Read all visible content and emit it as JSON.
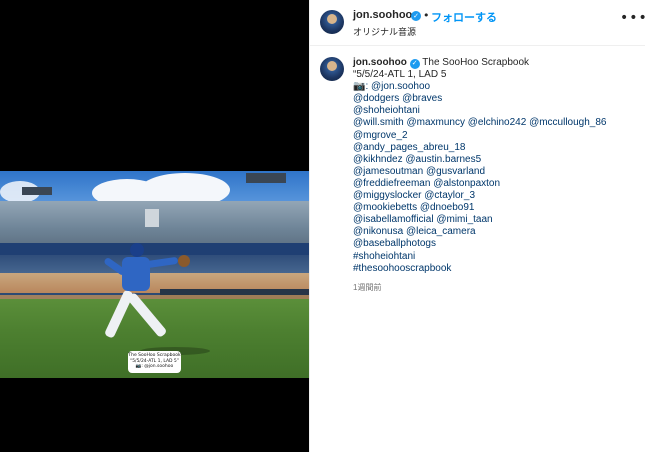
{
  "post": {
    "photo": {
      "caption_card_lines": [
        "The SooHoo Scrapbook",
        "“5/5/24-ATL 1, LAD 5”",
        "📷: @jon.soohoo"
      ]
    }
  },
  "header": {
    "username": "jon.soohoo",
    "verified": "✓",
    "dot": "•",
    "follow_label": "フォローする",
    "subtitle": "オリジナル音源",
    "more_icon": "•••"
  },
  "caption": {
    "username": "jon.soohoo",
    "verified": "✓",
    "title": "The SooHoo Scrapbook",
    "lines": [
      "“5/5/24-ATL 1, LAD 5",
      "📷: @jon.soohoo",
      "@dodgers @braves",
      "@shoheiohtani",
      "@will.smith @maxmuncy @elchino242 @mccullough_86",
      "@mgrove_2",
      "@andy_pages_abreu_18",
      "@kikhndez @austin.barnes5",
      "@jamesoutman @gusvarland",
      "@freddiefreeman @alstonpaxton",
      "@miggyslocker @ctaylor_3",
      "@mookiebetts @dnoebo91",
      "@isabellamofficial @mimi_taan",
      "@nikonusa @leica_camera",
      "@baseballphotogs",
      "#shoheiohtani",
      "#thesoohooscrapbook"
    ],
    "timestamp": "1週間前"
  },
  "colors": {
    "accent": "#0095f6",
    "link": "#00376b",
    "verified": "#1d9bf0",
    "muted": "#737373"
  }
}
